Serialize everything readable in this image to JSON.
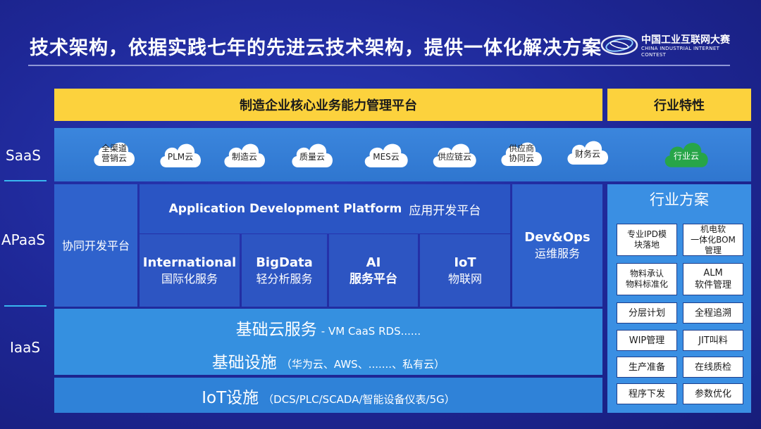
{
  "header": {
    "title": "技术架构，依据实践七年的先进云技术架构，提供一体化解决方案",
    "logo_cn": "中国工业互联网大赛",
    "logo_en_line1": "CHINA INDUSTRIAL INTERNET",
    "logo_en_line2": "CONTEST"
  },
  "top_bands": {
    "platform": "制造企业核心业务能力管理平台",
    "industry": "行业特性"
  },
  "layers": {
    "saas": "SaaS",
    "apaas": "APaaS",
    "iaas": "IaaS"
  },
  "saas": {
    "clouds": [
      {
        "line1": "全渠道",
        "line2": "营销云"
      },
      {
        "line1": "PLM云",
        "line2": ""
      },
      {
        "line1": "制造云",
        "line2": ""
      },
      {
        "line1": "质量云",
        "line2": ""
      },
      {
        "line1": "MES云",
        "line2": ""
      },
      {
        "line1": "供应链云",
        "line2": ""
      },
      {
        "line1": "供应商",
        "line2": "协同云"
      },
      {
        "line1": "财务云",
        "line2": ""
      }
    ],
    "industry_cloud": "行业云"
  },
  "apaas": {
    "collab": "协同开发平台",
    "adp_en": "Application Development Platform",
    "adp_cn": "应用开发平台",
    "modules": [
      {
        "en": "International",
        "cn": "国际化服务"
      },
      {
        "en": "BigData",
        "cn": "轻分析服务"
      },
      {
        "en": "AI",
        "cn": "服务平台"
      },
      {
        "en": "IoT",
        "cn": "物联网"
      }
    ],
    "devops_en": "Dev&Ops",
    "devops_cn": "运维服务"
  },
  "iaas": {
    "cloud_services_big": "基础云服务",
    "cloud_services_small": "- VM  CaaS  RDS......",
    "infra_big": "基础设施",
    "infra_small": "（华为云、AWS、.......、私有云）",
    "iot_big": "IoT设施",
    "iot_small": "（DCS/PLC/SCADA/智能设备仪表/5G）"
  },
  "industry_solutions": {
    "title": "行业方案",
    "cells": [
      {
        "line1": "专业IPD模",
        "line2": "块落地"
      },
      {
        "line1": "机电软",
        "line2": "一体化BOM",
        "line3": "管理"
      },
      {
        "line1": "物料承认",
        "line2": "物料标准化"
      },
      {
        "line1": "ALM",
        "line2": "软件管理"
      },
      {
        "line1": "分层计划"
      },
      {
        "line1": "全程追溯"
      },
      {
        "line1": "WIP管理"
      },
      {
        "line1": "JIT叫料"
      },
      {
        "line1": "生产准备"
      },
      {
        "line1": "在线质检"
      },
      {
        "line1": "程序下发"
      },
      {
        "line1": "参数优化"
      }
    ]
  },
  "colors": {
    "background": "#1e2796",
    "yellow_band": "#fcd23d",
    "saas_band": "#3b86dd",
    "apaas_block": "#2a55c4",
    "iaas_block": "#3590e0",
    "industry_cloud": "#27a548",
    "accent_rule": "#39b7f0"
  }
}
